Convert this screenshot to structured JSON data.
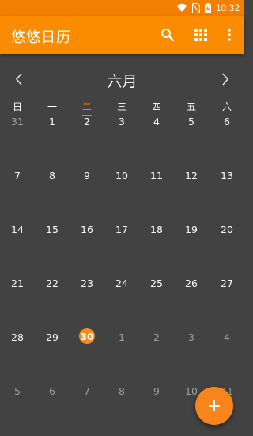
{
  "status_bar": {
    "time": "10:32",
    "icons": [
      "wifi-icon",
      "no-sim-icon",
      "battery-charging-icon"
    ]
  },
  "app_bar": {
    "title": "悠悠日历",
    "actions": [
      "search-icon",
      "grid-view-icon",
      "more-vert-icon"
    ]
  },
  "calendar": {
    "month_title": "六月",
    "prev_icon": "chevron-left-icon",
    "next_icon": "chevron-right-icon",
    "weekdays": [
      "日",
      "一",
      "二",
      "三",
      "四",
      "五",
      "六"
    ],
    "highlighted_weekday_index": 2,
    "weeks": [
      [
        "31",
        "1",
        "2",
        "3",
        "4",
        "5",
        "6"
      ],
      [
        "7",
        "8",
        "9",
        "10",
        "11",
        "12",
        "13"
      ],
      [
        "14",
        "15",
        "16",
        "17",
        "18",
        "19",
        "20"
      ],
      [
        "21",
        "22",
        "23",
        "24",
        "25",
        "26",
        "27"
      ],
      [
        "28",
        "29",
        "30",
        "1",
        "2",
        "3",
        "4"
      ],
      [
        "5",
        "6",
        "7",
        "8",
        "9",
        "10",
        "11"
      ]
    ],
    "today": "30"
  },
  "fab": {
    "icon": "plus-icon"
  },
  "colors": {
    "accent": "#fb8c00",
    "status_bar": "#f27f00",
    "background": "#424242",
    "today_circle": "#f48c1c",
    "muted_text": "#9e9e9e"
  }
}
